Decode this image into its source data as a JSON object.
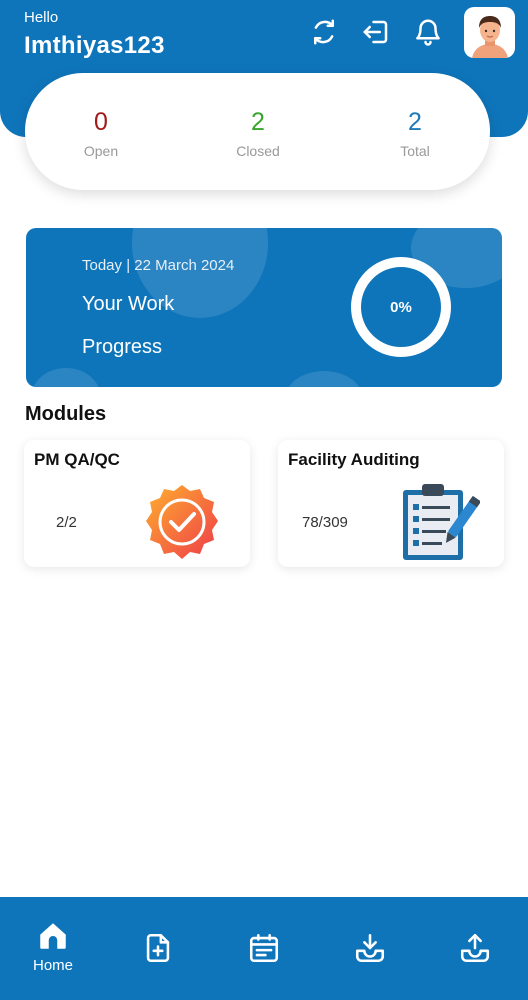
{
  "header": {
    "greeting": "Hello",
    "username": "Imthiyas123",
    "icons": [
      "refresh-icon",
      "logout-icon",
      "bell-icon"
    ],
    "avatar": "user-avatar"
  },
  "stats": [
    {
      "value": "0",
      "label": "Open",
      "color": "#a11b1b"
    },
    {
      "value": "2",
      "label": "Closed",
      "color": "#3aa52c"
    },
    {
      "value": "2",
      "label": "Total",
      "color": "#1e7ab8"
    }
  ],
  "progress": {
    "date": "Today | 22 March 2024",
    "line1": "Your Work",
    "line2": "Progress",
    "percent_label": "0%",
    "percent_value": 0
  },
  "modules": {
    "title": "Modules",
    "items": [
      {
        "title": "PM QA/QC",
        "count": "2/2",
        "icon": "badge-check-icon"
      },
      {
        "title": "Facility Auditing",
        "count": "78/309",
        "icon": "clipboard-pen-icon"
      }
    ]
  },
  "bottom_nav": [
    {
      "label": "Home",
      "icon": "home-icon"
    },
    {
      "label": "",
      "icon": "add-document-icon"
    },
    {
      "label": "",
      "icon": "calendar-icon"
    },
    {
      "label": "",
      "icon": "download-tray-icon"
    },
    {
      "label": "",
      "icon": "upload-tray-icon"
    }
  ],
  "colors": {
    "primary": "#0f75bb",
    "open": "#a11b1b",
    "closed": "#3aa52c",
    "total": "#1e7ab8"
  }
}
